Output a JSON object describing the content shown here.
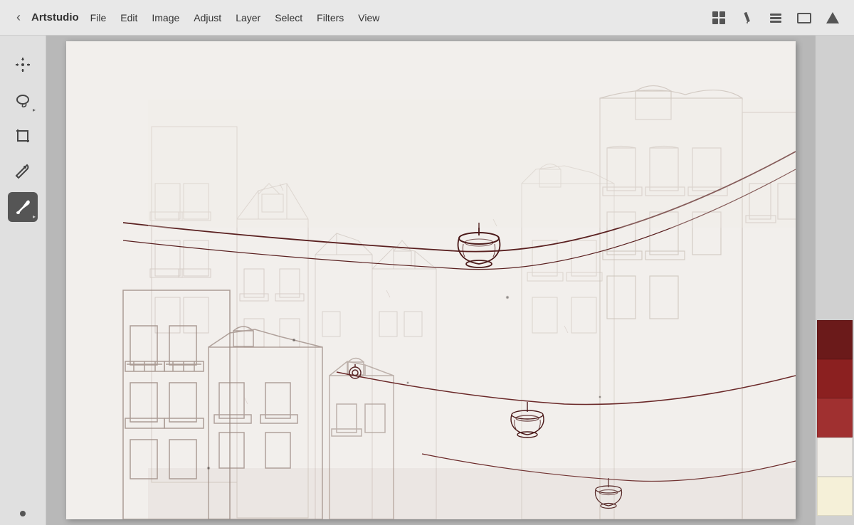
{
  "app": {
    "title": "Artstudio",
    "back_label": "‹"
  },
  "menubar": {
    "items": [
      "File",
      "Edit",
      "Image",
      "Adjust",
      "Layer",
      "Select",
      "Filters",
      "View"
    ],
    "icons": {
      "pencil": "✏",
      "layers": "⊞",
      "frame": "▭",
      "triangle": "▲"
    }
  },
  "toolbar": {
    "tools": [
      {
        "id": "move",
        "label": "⊕",
        "has_arrow": false
      },
      {
        "id": "lasso",
        "label": "◯",
        "has_arrow": true
      },
      {
        "id": "crop",
        "label": "✂",
        "has_arrow": false
      },
      {
        "id": "eyedropper",
        "label": "⊘",
        "has_arrow": false
      },
      {
        "id": "brush",
        "label": "✒",
        "has_arrow": true,
        "active": true
      }
    ],
    "dot_label": "•"
  },
  "colors": [
    "#6B1A1A",
    "#8B2020",
    "#A03030",
    "#F0EDE8",
    "#F5F0D8"
  ],
  "canvas": {
    "background": "#f5f3f0"
  }
}
